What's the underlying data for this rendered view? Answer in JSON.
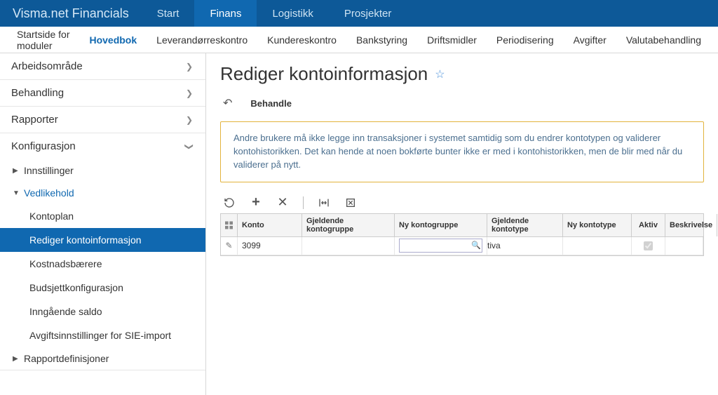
{
  "brand": "Visma.net Financials",
  "topnav": [
    {
      "label": "Start",
      "active": false
    },
    {
      "label": "Finans",
      "active": true
    },
    {
      "label": "Logistikk",
      "active": false
    },
    {
      "label": "Prosjekter",
      "active": false
    }
  ],
  "subnav": [
    {
      "label": "Startside for moduler",
      "active": false
    },
    {
      "label": "Hovedbok",
      "active": true
    },
    {
      "label": "Leverandørreskontro",
      "active": false
    },
    {
      "label": "Kundereskontro",
      "active": false
    },
    {
      "label": "Bankstyring",
      "active": false
    },
    {
      "label": "Driftsmidler",
      "active": false
    },
    {
      "label": "Periodisering",
      "active": false
    },
    {
      "label": "Avgifter",
      "active": false
    },
    {
      "label": "Valutabehandling",
      "active": false
    }
  ],
  "sidebar": {
    "groups": [
      {
        "label": "Arbeidsområde",
        "expanded": false
      },
      {
        "label": "Behandling",
        "expanded": false
      },
      {
        "label": "Rapporter",
        "expanded": false
      },
      {
        "label": "Konfigurasjon",
        "expanded": true,
        "children": [
          {
            "label": "Innstillinger",
            "type": "sub",
            "expanded": false
          },
          {
            "label": "Vedlikehold",
            "type": "sub",
            "expanded": true,
            "items": [
              {
                "label": "Kontoplan",
                "active": false
              },
              {
                "label": "Rediger kontoinformasjon",
                "active": true
              },
              {
                "label": "Kostnadsbærere",
                "active": false
              },
              {
                "label": "Budsjettkonfigurasjon",
                "active": false
              },
              {
                "label": "Inngående saldo",
                "active": false
              },
              {
                "label": "Avgiftsinnstillinger for SIE-import",
                "active": false
              }
            ]
          },
          {
            "label": "Rapportdefinisjoner",
            "type": "sub",
            "expanded": false
          }
        ]
      }
    ]
  },
  "page": {
    "title": "Rediger kontoinformasjon",
    "action_label": "Behandle",
    "alert": "Andre brukere må ikke legge inn transaksjoner i systemet samtidig som du endrer  kontotypen og validerer kontohistorikken. Det kan hende at noen bokførte bunter ikke er med i kontohistorikken, men de blir med når du validerer på nytt."
  },
  "grid": {
    "columns": {
      "konto": "Konto",
      "gkg": "Gjeldende kontogruppe",
      "nkg": "Ny kontogruppe",
      "gkt": "Gjeldende kontotype",
      "nkt": "Ny kontotype",
      "aktiv": "Aktiv",
      "besk": "Beskrivelse"
    },
    "rows": [
      {
        "konto": "3099",
        "gkg": "",
        "nkg_value": "",
        "gkt": "tiva",
        "nkt": "",
        "aktiv": true,
        "besk": ""
      }
    ]
  }
}
